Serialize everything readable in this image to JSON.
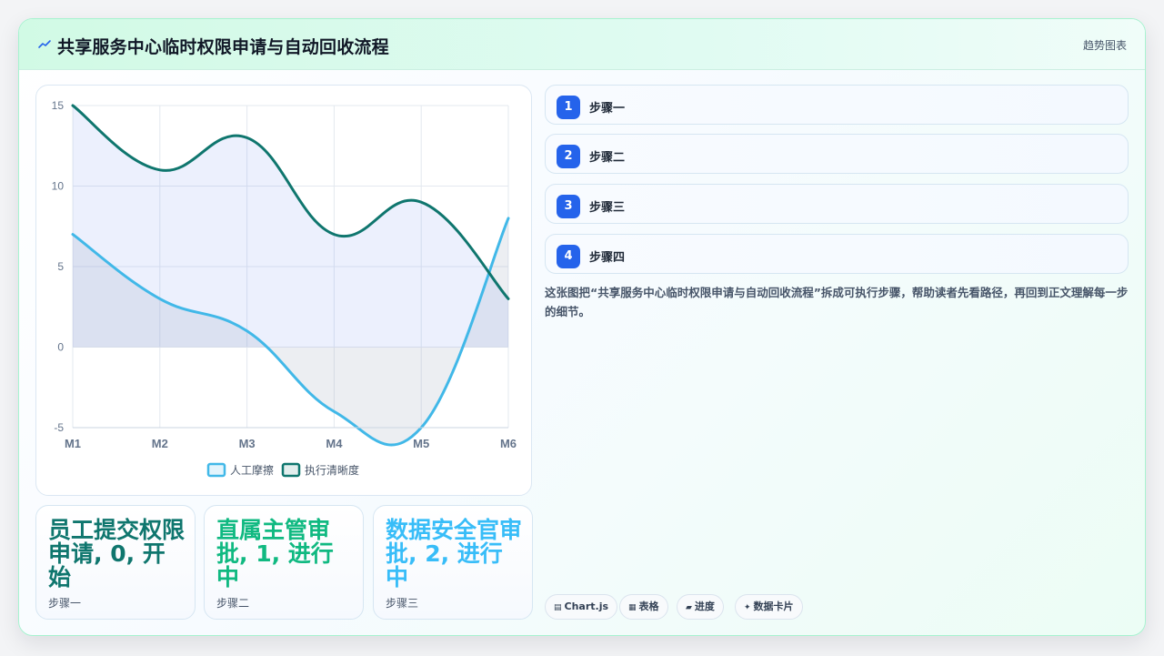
{
  "header": {
    "title": "共享服务中心临时权限申请与自动回收流程",
    "link_label": "趋势图表"
  },
  "chart_data": {
    "type": "line",
    "categories": [
      "M1",
      "M2",
      "M3",
      "M4",
      "M5",
      "M6"
    ],
    "ylim": [
      -5,
      15
    ],
    "y_ticks": [
      "15",
      "10",
      "5",
      "0",
      "-5"
    ],
    "grid": true,
    "legend_position": "bottom",
    "series": [
      {
        "name": "人工摩擦",
        "values": [
          7,
          3,
          1,
          -4,
          -5,
          8
        ],
        "color": "#41b8e8",
        "fill": true
      },
      {
        "name": "执行清晰度",
        "values": [
          15,
          11,
          13,
          7,
          9,
          3
        ],
        "color": "#0f766e",
        "fill": true
      }
    ]
  },
  "stats": [
    {
      "value": "员工提交权限申请, 0, 开始",
      "label": "步骤一",
      "color": "#0f766e"
    },
    {
      "value": "直属主管审批, 1, 进行中",
      "label": "步骤二",
      "color": "#10b981"
    },
    {
      "value": "数据安全官审批, 2, 进行中",
      "label": "步骤三",
      "color": "#38bdf8"
    }
  ],
  "steps": [
    {
      "num": "1",
      "label": "步骤一"
    },
    {
      "num": "2",
      "label": "步骤二"
    },
    {
      "num": "3",
      "label": "步骤三"
    },
    {
      "num": "4",
      "label": "步骤四"
    }
  ],
  "description": "这张图把“共享服务中心临时权限申请与自动回收流程”拆成可执行步骤，帮助读者先看路径，再回到正文理解每一步的细节。",
  "tags": [
    {
      "icon": "chart-icon",
      "label": "Chart.js"
    },
    {
      "icon": "table-icon",
      "label": "表格"
    },
    {
      "icon": "progress-icon",
      "label": "进度"
    },
    {
      "icon": "sparkle-icon",
      "label": "数据卡片"
    }
  ],
  "colors": {
    "accent": "#2563eb",
    "brand": "#0f766e"
  }
}
